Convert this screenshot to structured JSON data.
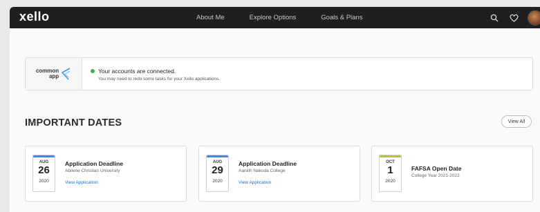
{
  "header": {
    "logo": "xello",
    "nav": [
      "About Me",
      "Explore Options",
      "Goals & Plans"
    ],
    "icons": [
      "search-icon",
      "heart-icon",
      "avatar"
    ],
    "bg_color": "#1f1f1f"
  },
  "connection": {
    "logo_line1": "common",
    "logo_line2": "app",
    "title": "Your accounts are connected.",
    "subtitle": "You may need to redo some tasks for your Xello applications.",
    "status_color": "#3bb34a"
  },
  "dates": {
    "title": "IMPORTANT DATES",
    "view_all": "View All",
    "cards": [
      {
        "month": "AUG",
        "day": "26",
        "year": "2020",
        "title": "Application Deadline",
        "subtitle": "Abilene Christian University",
        "link": "View Application",
        "accent": "#4a86d9"
      },
      {
        "month": "AUG",
        "day": "29",
        "year": "2020",
        "title": "Application Deadline",
        "subtitle": "Aaniiih Nakoda College",
        "link": "View Application",
        "accent": "#4a86d9"
      },
      {
        "month": "OCT",
        "day": "1",
        "year": "2020",
        "title": "FAFSA Open Date",
        "subtitle": "College Year 2021-2022",
        "link": "",
        "accent": "#b5c52a"
      }
    ]
  }
}
